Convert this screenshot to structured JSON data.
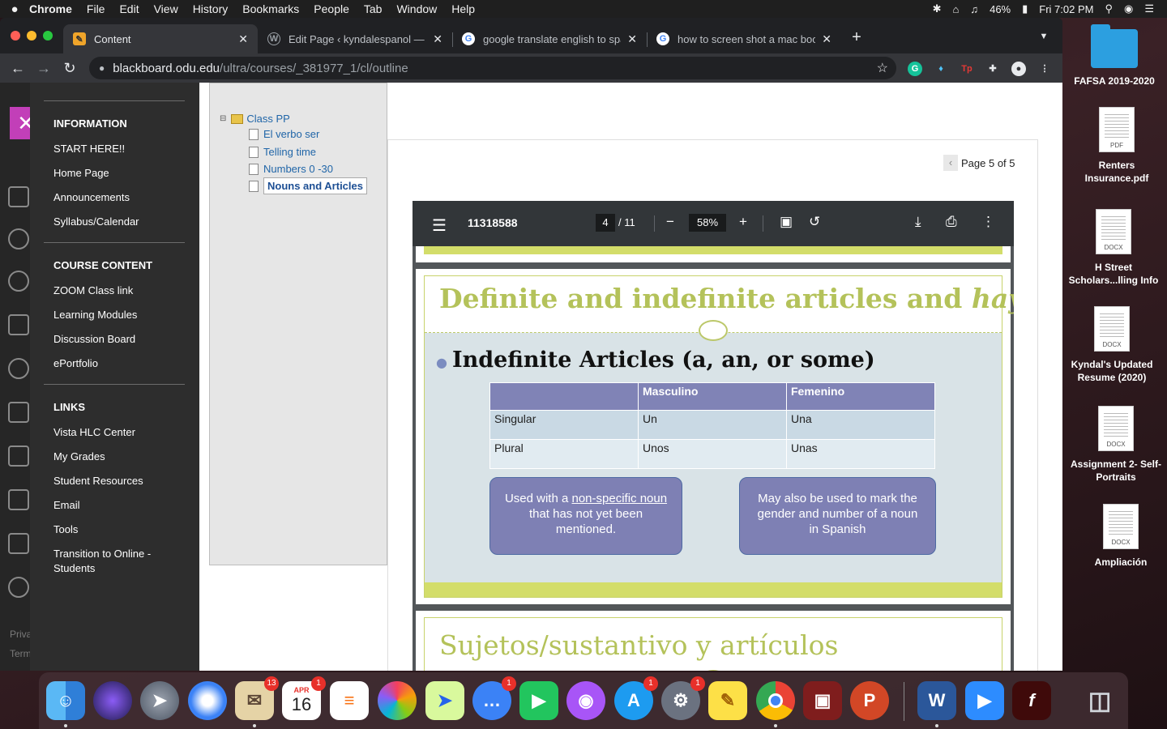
{
  "menubar": {
    "apple": "",
    "app": "Chrome",
    "items": [
      "File",
      "Edit",
      "View",
      "History",
      "Bookmarks",
      "People",
      "Tab",
      "Window",
      "Help"
    ],
    "battery": "46%",
    "clock": "Fri 7:02 PM"
  },
  "tabs": [
    {
      "title": "Content",
      "icon": "blackboard-icon",
      "color": "#f0a52a"
    },
    {
      "title": "Edit Page ‹ kyndalespanol — W",
      "icon": "wordpress-icon",
      "color": "#9aa0a6"
    },
    {
      "title": "google translate english to spa",
      "icon": "google-icon",
      "color": "#ffffff"
    },
    {
      "title": "how to screen shot a mac book",
      "icon": "google-icon",
      "color": "#ffffff"
    }
  ],
  "omnibox": {
    "host": "blackboard.odu.edu",
    "path": "/ultra/courses/_381977_1/cl/outline"
  },
  "rail": {
    "text1": "Priva",
    "text2": "Term"
  },
  "coursenav": {
    "information": {
      "title": "INFORMATION",
      "links": [
        "START HERE!!",
        "Home Page",
        "Announcements",
        "Syllabus/Calendar"
      ]
    },
    "course_content": {
      "title": "COURSE CONTENT",
      "links": [
        "ZOOM Class link",
        "Learning Modules",
        "Discussion Board",
        "ePortfolio"
      ]
    },
    "links_section": {
      "title": "LINKS",
      "links": [
        "Vista HLC Center",
        "My Grades",
        "Student Resources",
        "Email",
        "Tools",
        "Transition to Online - Students"
      ]
    }
  },
  "tree": {
    "folder": "Class PP",
    "items": [
      "El verbo ser",
      "Telling time",
      "Numbers 0 -30"
    ],
    "selected": "Nouns and Articles"
  },
  "pager": {
    "text": "Page 5 of 5"
  },
  "pdf": {
    "docname": "11318588",
    "page": "4",
    "total": "/ 11",
    "zoom": "58%"
  },
  "slide": {
    "title_plain": "Definite and indefinite articles and ",
    "title_italic": "hay",
    "bullet": "Indefinite Articles (a, an, or some)",
    "table": {
      "headers": [
        "",
        "Masculino",
        "Femenino"
      ],
      "rows": [
        [
          "Singular",
          "Un",
          "Una"
        ],
        [
          "Plural",
          "Unos",
          "Unas"
        ]
      ]
    },
    "note1": {
      "before": "Used with a ",
      "underlined": "non-specific noun ",
      "after": "that has not yet been mentioned."
    },
    "note2": "May also be used to mark the gender and number of a noun in Spanish"
  },
  "slide2": {
    "title": "Sujetos/sustantivo y artículos"
  },
  "desktop": [
    {
      "label": "FAFSA 2019-2020",
      "kind": "folder"
    },
    {
      "label": "Renters Insurance.pdf",
      "kind": "PDF"
    },
    {
      "label": "H Street Scholars...lling Info",
      "kind": "DOCX"
    },
    {
      "label": "Kyndal's Updated Resume (2020)",
      "kind": "DOCX"
    },
    {
      "label": "Assignment 2- Self-Portraits",
      "kind": "DOCX"
    },
    {
      "label": "Ampliación",
      "kind": "DOCX"
    }
  ],
  "dock": {
    "mail_badge": "13",
    "calendar_badge": "1",
    "calendar_month": "APR",
    "calendar_day": "16",
    "messages_badge": "1",
    "appstore_badge": "1",
    "prefs_badge": "1"
  }
}
